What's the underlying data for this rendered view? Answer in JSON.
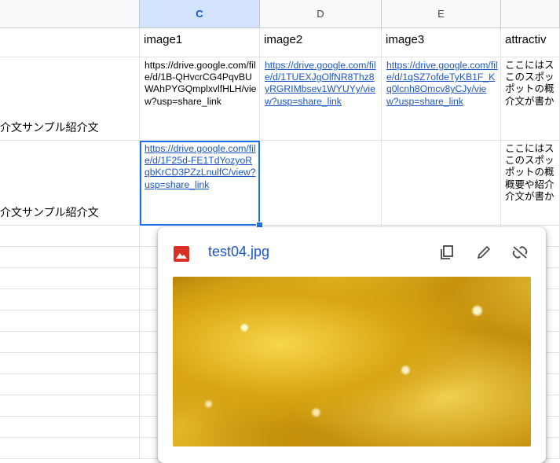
{
  "columns": [
    {
      "letter": "",
      "selected": false
    },
    {
      "letter": "C",
      "selected": true
    },
    {
      "letter": "D",
      "selected": false
    },
    {
      "letter": "E",
      "selected": false
    },
    {
      "letter": "",
      "selected": false
    }
  ],
  "header_row": [
    "",
    "image1",
    "image2",
    "image3",
    "attractiv"
  ],
  "rows": [
    {
      "a": "介文サンプル紹介文",
      "c": "https://drive.google.com/file/d/1B-QHvcrCG4PqvBUWAhPYGQmplxvlfHLH/view?usp=share_link",
      "c_link": false,
      "d": "https://drive.google.com/file/d/1TUEXJgOlfNR8Thz8yRGRIMbsev1WYUYy/view?usp=share_link",
      "e": "https://drive.google.com/file/d/1qSZ7ofdeTyKB1F_Kq0lcnh8Omcv8yCJy/view?usp=share_link",
      "f": [
        "ここにはス",
        "このスポッ",
        "ポットの概",
        "介文が書か"
      ]
    },
    {
      "a": "介文サンプル紹介文",
      "c": "https://drive.google.com/file/d/1F25d-FE1TdYozyoRqbKrCD3PZzLnulfC/view?usp=share_link",
      "c_link": true,
      "d": "",
      "e": "",
      "f": [
        "ここにはス",
        "このスポッ",
        "ポットの概",
        "概要や紹介",
        "介文が書か"
      ]
    }
  ],
  "popup": {
    "filename": "test04.jpg",
    "icons": {
      "file": "image-file-icon",
      "copy": "copy-icon",
      "edit": "pencil-icon",
      "unlink": "unlink-icon"
    },
    "colors": {
      "file_icon": "#d93025",
      "link": "#1a55c8",
      "selection": "#1a73e8"
    }
  }
}
